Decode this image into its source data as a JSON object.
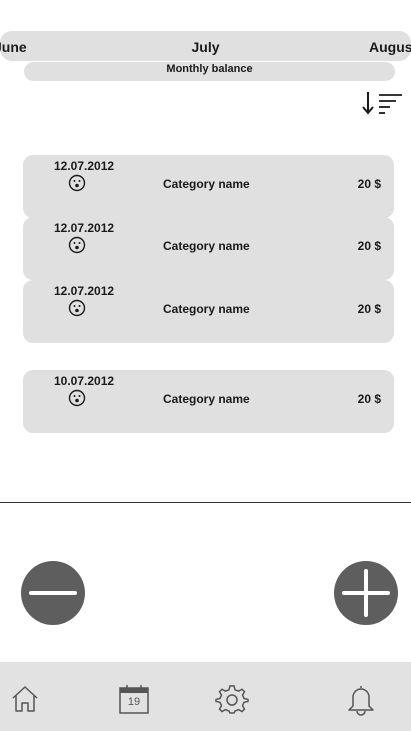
{
  "months": {
    "prev": "June",
    "current": "July",
    "next": "August"
  },
  "balance_label": "Monthly balance",
  "transactions": [
    {
      "date": "12.07.2012",
      "category": "Category name",
      "amount": "20 $",
      "icon": "surprised-face-icon"
    },
    {
      "date": "12.07.2012",
      "category": "Category name",
      "amount": "20 $",
      "icon": "surprised-face-icon"
    },
    {
      "date": "12.07.2012",
      "category": "Category name",
      "amount": "20 $",
      "icon": "surprised-face-icon"
    },
    {
      "date": "10.07.2012",
      "category": "Category name",
      "amount": "20 $",
      "icon": "surprised-face-icon"
    }
  ],
  "bottom_nav": {
    "items": [
      {
        "icon": "home-icon"
      },
      {
        "icon": "calendar-icon",
        "label": "19"
      },
      {
        "icon": "gear-icon"
      },
      {
        "icon": "bell-icon"
      }
    ]
  },
  "actions": {
    "remove": "minus-icon",
    "add": "plus-icon"
  },
  "colors": {
    "surface": "#e0e0e0",
    "fab": "#5e5e5e",
    "nav": "#e2e2e2"
  }
}
